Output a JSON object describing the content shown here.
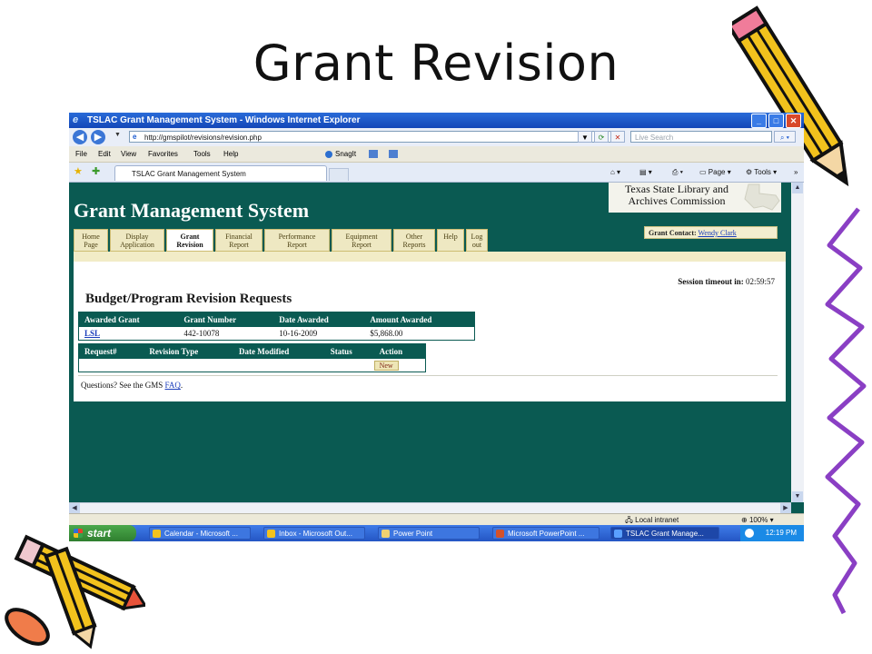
{
  "slide": {
    "title": "Grant Revision"
  },
  "browser": {
    "window_title": "TSLAC Grant Management System - Windows Internet Explorer",
    "address": "http://gmspilot/revisions/revision.php",
    "search_placeholder": "Live Search",
    "menu": [
      "File",
      "Edit",
      "View",
      "Favorites",
      "Tools",
      "Help"
    ],
    "snagit_label": "SnagIt",
    "tab_label": "TSLAC Grant Management System",
    "page_cmd": "Page",
    "tools_cmd": "Tools"
  },
  "page": {
    "title": "Grant Management System",
    "agency": "Texas State Library and Archives Commission",
    "grant_contact_label": "Grant Contact:",
    "grant_contact_name": "Wendy Clark",
    "nav": [
      {
        "line1": "Home",
        "line2": "Page"
      },
      {
        "line1": "Display",
        "line2": "Application"
      },
      {
        "line1": "Grant",
        "line2": "Revision"
      },
      {
        "line1": "Financial",
        "line2": "Report"
      },
      {
        "line1": "Performance",
        "line2": "Report"
      },
      {
        "line1": "Equipment",
        "line2": "Report"
      },
      {
        "line1": "Other",
        "line2": "Reports"
      },
      {
        "line1": "Help",
        "line2": ""
      },
      {
        "line1": "Log",
        "line2": "out"
      }
    ],
    "session_timeout_label": "Session timeout in:",
    "session_timeout_value": "02:59:57",
    "section_heading": "Budget/Program Revision Requests",
    "grants_table": {
      "headers": [
        "Awarded Grant",
        "Grant Number",
        "Date Awarded",
        "Amount Awarded"
      ],
      "rows": [
        [
          "LSL",
          "442-10078",
          "10-16-2009",
          "$5,868.00"
        ]
      ]
    },
    "requests_table": {
      "headers": [
        "Request#",
        "Revision Type",
        "Date Modified",
        "Status",
        "Action"
      ],
      "new_button": "New"
    },
    "faq_prefix": "Questions? See the GMS",
    "faq_link": "FAQ",
    "faq_suffix": "."
  },
  "statusbar": {
    "zone": "Local intranet",
    "zoom": "100%"
  },
  "taskbar": {
    "start": "start",
    "items": [
      "Calendar - Microsoft ...",
      "Inbox - Microsoft Out...",
      "Power Point",
      "Microsoft PowerPoint ...",
      "TSLAC Grant Manage..."
    ],
    "clock": "12:19 PM"
  },
  "colors": {
    "teal": "#0a5a52",
    "tab_bg": "#eee8c2",
    "link": "#1a3dbb"
  }
}
